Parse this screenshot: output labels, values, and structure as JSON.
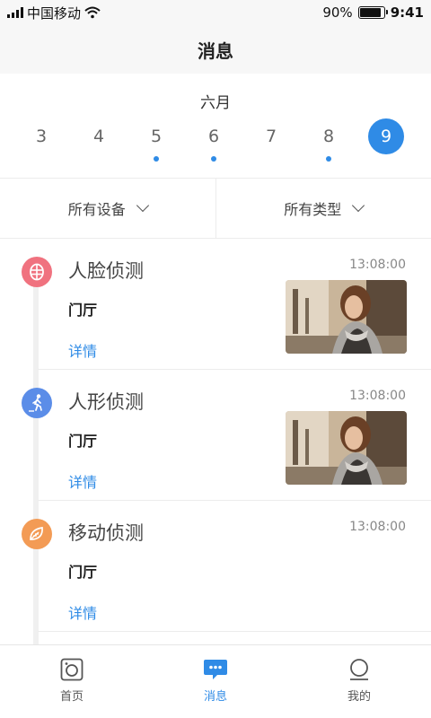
{
  "status_bar": {
    "carrier": "中国移动",
    "battery_text": "90%",
    "battery_level": 0.9,
    "time": "9:41"
  },
  "header": {
    "title": "消息"
  },
  "calendar": {
    "month": "六月",
    "days": [
      {
        "label": "3",
        "has_event": false,
        "selected": false
      },
      {
        "label": "4",
        "has_event": false,
        "selected": false
      },
      {
        "label": "5",
        "has_event": true,
        "selected": false
      },
      {
        "label": "6",
        "has_event": true,
        "selected": false
      },
      {
        "label": "7",
        "has_event": false,
        "selected": false
      },
      {
        "label": "8",
        "has_event": true,
        "selected": false
      },
      {
        "label": "9",
        "has_event": false,
        "selected": true
      }
    ]
  },
  "filters": {
    "device_label": "所有设备",
    "type_label": "所有类型"
  },
  "events": [
    {
      "title": "人脸侦测",
      "time": "13:08:00",
      "location": "门厅",
      "detail_label": "详情",
      "icon": "face-detect-icon",
      "icon_color": "#f0727f",
      "has_thumbnail": true
    },
    {
      "title": "人形侦测",
      "time": "13:08:00",
      "location": "门厅",
      "detail_label": "详情",
      "icon": "human-detect-icon",
      "icon_color": "#5b8de8",
      "has_thumbnail": true
    },
    {
      "title": "移动侦测",
      "time": "13:08:00",
      "location": "门厅",
      "detail_label": "详情",
      "icon": "motion-detect-icon",
      "icon_color": "#f39b55",
      "has_thumbnail": false
    }
  ],
  "tab_bar": {
    "items": [
      {
        "label": "首页",
        "icon": "camera-icon",
        "active": false
      },
      {
        "label": "消息",
        "icon": "message-icon",
        "active": true
      },
      {
        "label": "我的",
        "icon": "profile-icon",
        "active": false
      }
    ]
  },
  "colors": {
    "accent": "#2f8be6",
    "header_bg": "#f7f7f7"
  }
}
